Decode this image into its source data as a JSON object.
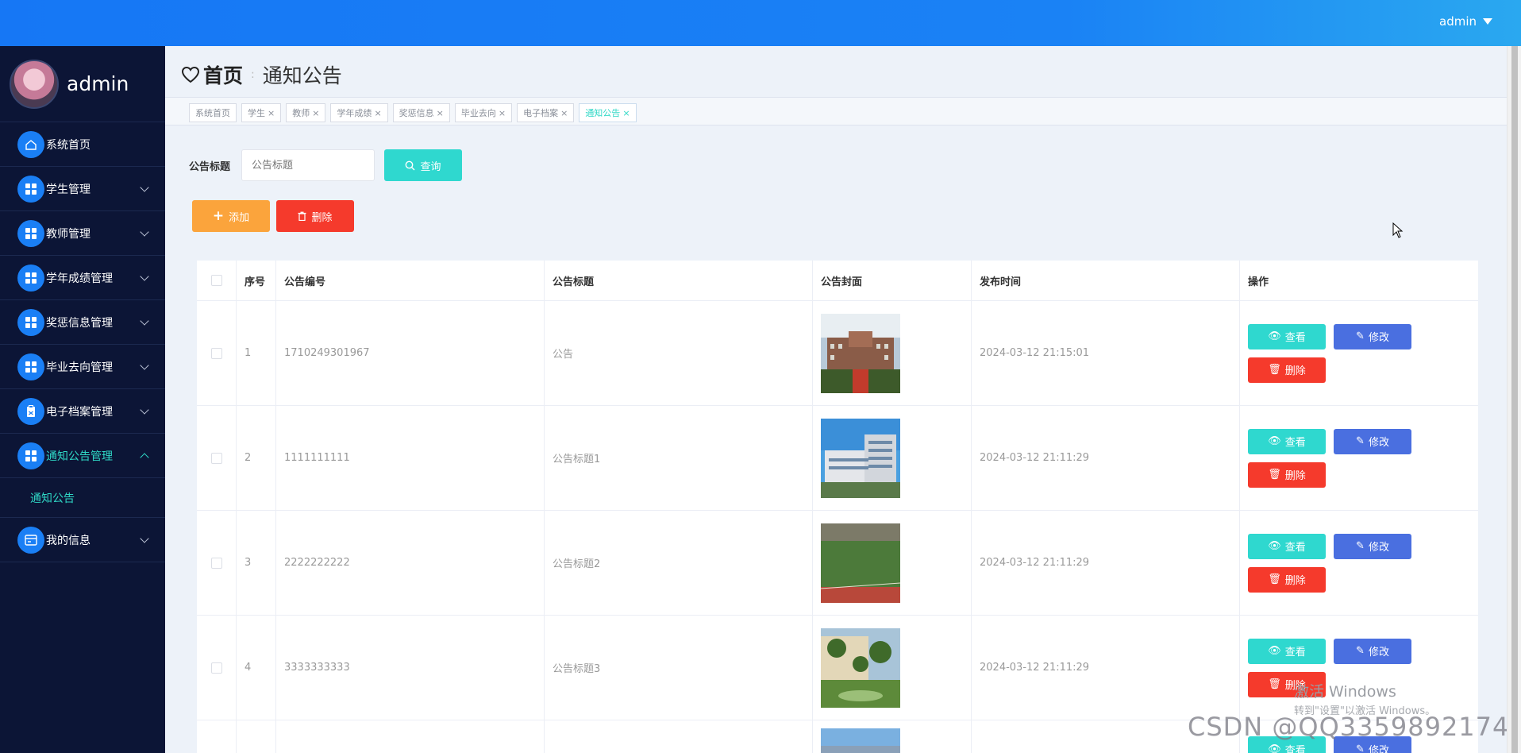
{
  "topbar": {
    "user_label": "admin"
  },
  "sidebar": {
    "profile_name": "admin",
    "items": [
      {
        "label": "系统首页",
        "icon": "home-icon",
        "has_chevron": false
      },
      {
        "label": "学生管理",
        "icon": "grid-icon",
        "has_chevron": true
      },
      {
        "label": "教师管理",
        "icon": "grid-icon",
        "has_chevron": true
      },
      {
        "label": "学年成绩管理",
        "icon": "grid-icon",
        "has_chevron": true
      },
      {
        "label": "奖惩信息管理",
        "icon": "grid-icon",
        "has_chevron": true
      },
      {
        "label": "毕业去向管理",
        "icon": "grid-icon",
        "has_chevron": true
      },
      {
        "label": "电子档案管理",
        "icon": "clipboard-icon",
        "has_chevron": true
      },
      {
        "label": "通知公告管理",
        "icon": "grid-icon",
        "has_chevron": true,
        "expanded": true
      },
      {
        "label": "我的信息",
        "icon": "card-icon",
        "has_chevron": true
      }
    ],
    "submenu_label": "通知公告"
  },
  "breadcrumb": {
    "home": "首页",
    "separator": ":",
    "current": "通知公告"
  },
  "tags": [
    {
      "label": "系统首页",
      "closable": false
    },
    {
      "label": "学生",
      "closable": true
    },
    {
      "label": "教师",
      "closable": true
    },
    {
      "label": "学年成绩",
      "closable": true
    },
    {
      "label": "奖惩信息",
      "closable": true
    },
    {
      "label": "毕业去向",
      "closable": true
    },
    {
      "label": "电子档案",
      "closable": true
    },
    {
      "label": "通知公告",
      "closable": true,
      "active": true
    }
  ],
  "search": {
    "label": "公告标题",
    "placeholder": "公告标题",
    "button": "查询"
  },
  "actions": {
    "add": "添加",
    "delete": "删除"
  },
  "table": {
    "headers": [
      "序号",
      "公告编号",
      "公告标题",
      "公告封面",
      "发布时间",
      "操作"
    ],
    "rows": [
      {
        "idx": "1",
        "no": "1710249301967",
        "title": "公告",
        "time": "2024-03-12 21:15:01",
        "image": "campus-building-photo"
      },
      {
        "idx": "2",
        "no": "1111111111",
        "title": "公告标题1",
        "time": "2024-03-12 21:11:29",
        "image": "modern-building-photo"
      },
      {
        "idx": "3",
        "no": "2222222222",
        "title": "公告标题2",
        "time": "2024-03-12 21:11:29",
        "image": "sports-field-photo"
      },
      {
        "idx": "4",
        "no": "3333333333",
        "title": "公告标题3",
        "time": "2024-03-12 21:11:29",
        "image": "palm-garden-photo"
      }
    ],
    "op_labels": {
      "view": "查看",
      "edit": "修改",
      "delete": "删除"
    }
  },
  "watermarks": {
    "windows_title": "激活 Windows",
    "windows_sub": "转到\"设置\"以激活 Windows。",
    "csdn": "CSDN @QQ3359892174"
  },
  "colors": {
    "topbar": "#1677f5",
    "sidebar": "#0c1536",
    "accent": "#2fd8cf",
    "edit": "#4a6fe0",
    "danger": "#f53a2c",
    "warning": "#fba43c"
  }
}
